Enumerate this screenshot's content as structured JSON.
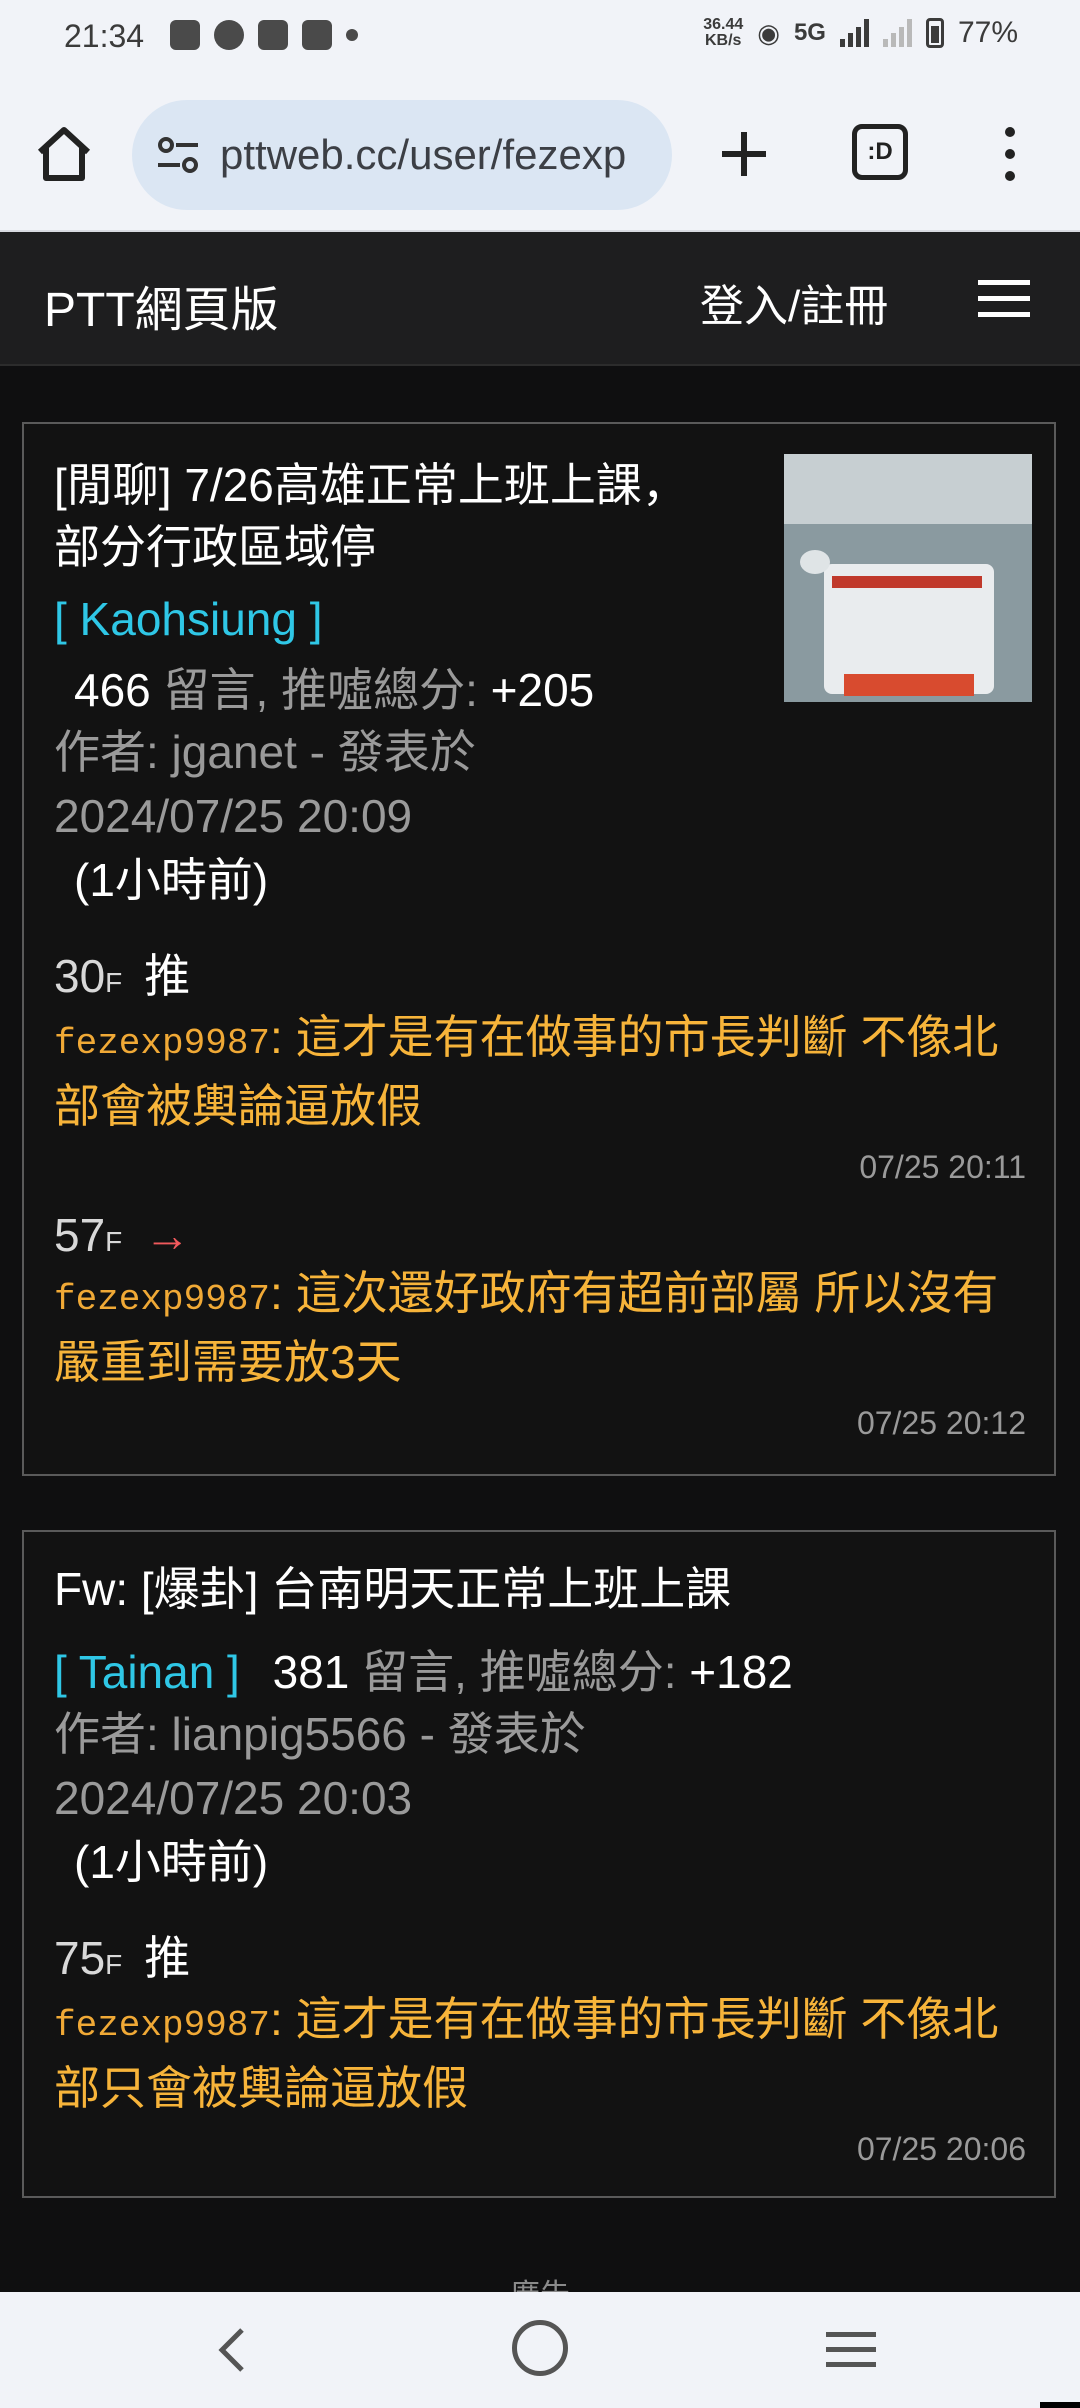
{
  "status_bar": {
    "time": "21:34",
    "speed_top": "36.44",
    "speed_unit": "KB/s",
    "network": "5G",
    "battery": "77%"
  },
  "browser": {
    "url": "pttweb.cc/user/fezexp",
    "tab_count_glyph": ":D"
  },
  "site": {
    "title": "PTT網頁版",
    "login_label": "登入/註冊"
  },
  "posts": [
    {
      "title": "[閒聊] 7/26高雄正常上班上課，部分行政區域停",
      "board": "[ Kaohsiung ]",
      "comment_count": "466",
      "comments_label": "留言, 推噓總分:",
      "score": "+205",
      "author_line": "作者: jganet - 發表於",
      "date": "2024/07/25 20:09",
      "ago": "(1小時前)",
      "comments": [
        {
          "floor": "30",
          "f": "F",
          "tag": "推",
          "user": "fezexp9987",
          "text": ": 這才是有在做事的市長判斷 不像北部會被輿論逼放假",
          "time": "07/25 20:11"
        },
        {
          "floor": "57",
          "f": "F",
          "tag": "→",
          "user": "fezexp9987",
          "text": ": 這次還好政府有超前部屬 所以沒有嚴重到需要放3天",
          "time": "07/25 20:12"
        }
      ]
    },
    {
      "title": "Fw: [爆卦] 台南明天正常上班上課",
      "board": "[ Tainan ]",
      "comment_count": "381",
      "comments_label": "留言, 推噓總分:",
      "score": "+182",
      "author_line": "作者: lianpig5566 - 發表於",
      "date": "2024/07/25 20:03",
      "ago": "(1小時前)",
      "comments": [
        {
          "floor": "75",
          "f": "F",
          "tag": "推",
          "user": "fezexp9987",
          "text": ": 這才是有在做事的市長判斷 不像北部只會被輿論逼放假",
          "time": "07/25 20:06"
        }
      ]
    }
  ],
  "ad_label": "廣告"
}
